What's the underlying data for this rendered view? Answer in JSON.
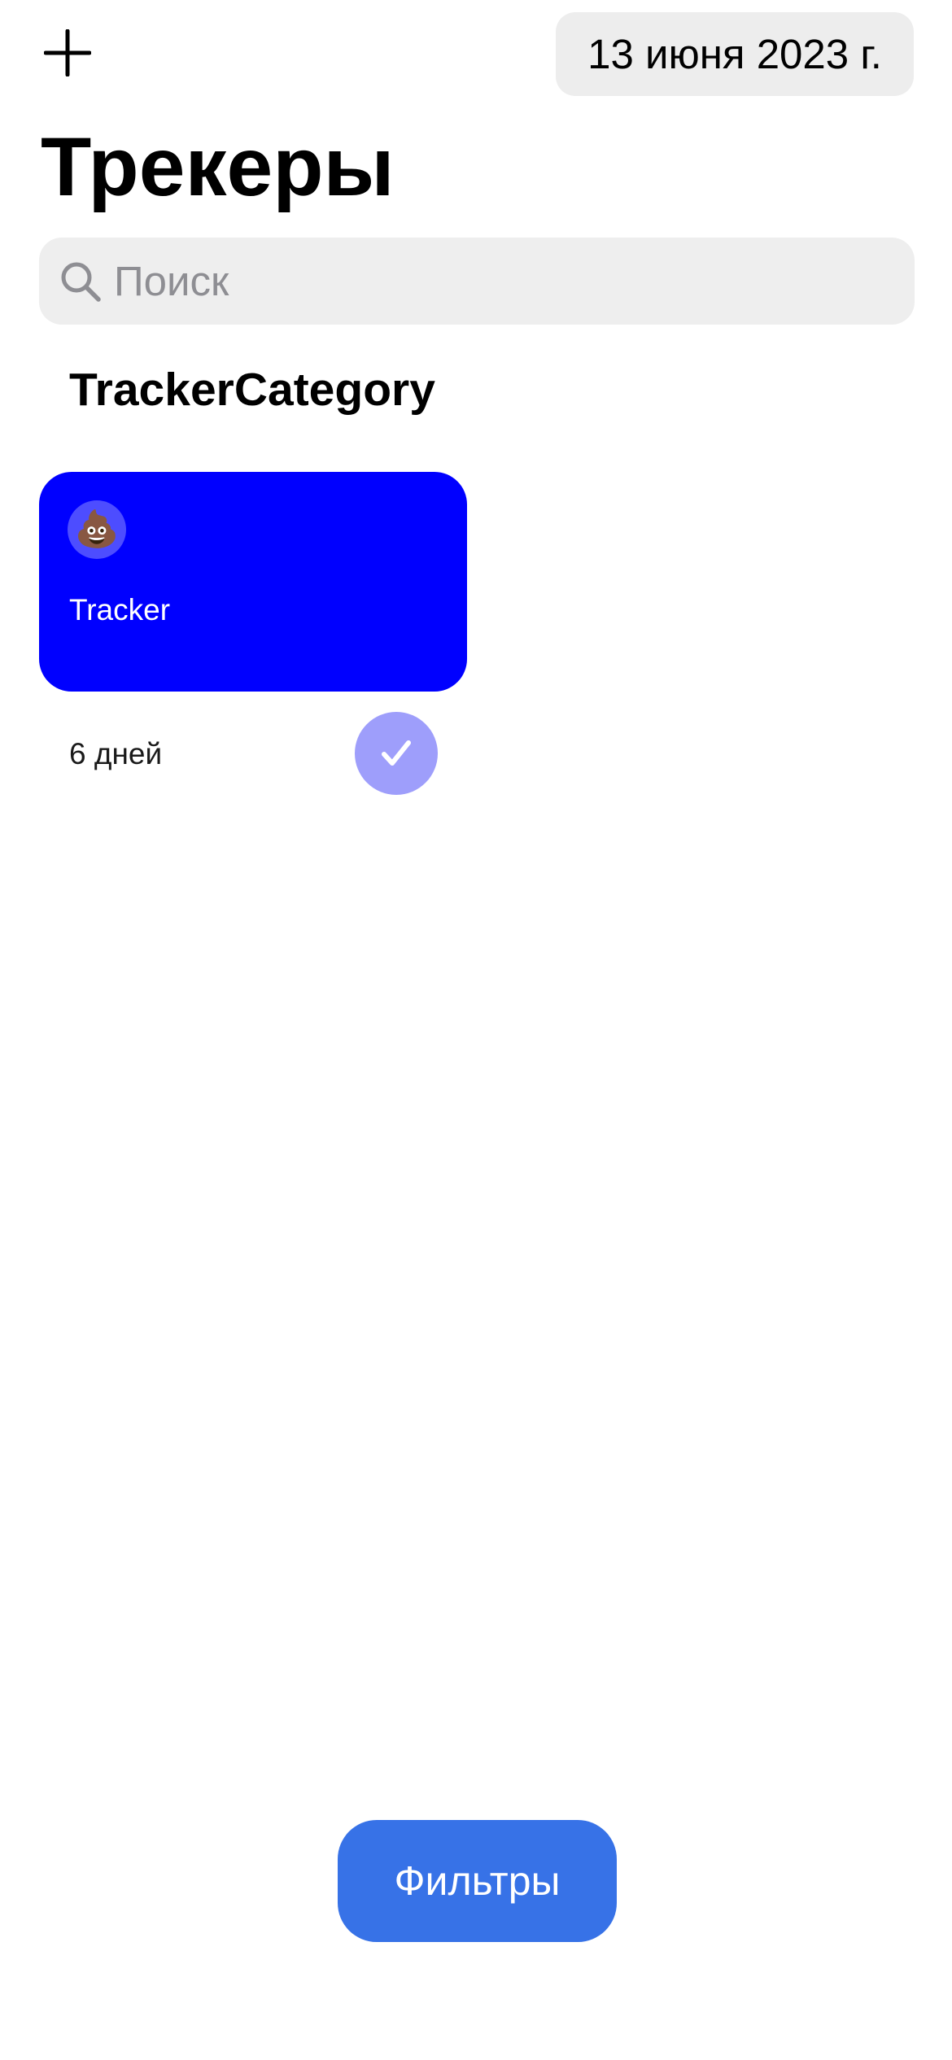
{
  "header": {
    "add_icon": "plus-icon",
    "date_label": "13 июня 2023 г.",
    "title": "Трекеры"
  },
  "search": {
    "icon": "search-icon",
    "placeholder": "Поиск",
    "value": ""
  },
  "categories": [
    {
      "title": "TrackerCategory",
      "trackers": [
        {
          "emoji": "💩",
          "name": "Tracker",
          "days": "6 дней",
          "color": "#0000FF",
          "done_button_color": "#9E9EFB",
          "done_icon": "checkmark-icon",
          "completed": true
        }
      ]
    }
  ],
  "footer": {
    "filters_label": "Фильтры",
    "filters_color": "#3772E7"
  }
}
